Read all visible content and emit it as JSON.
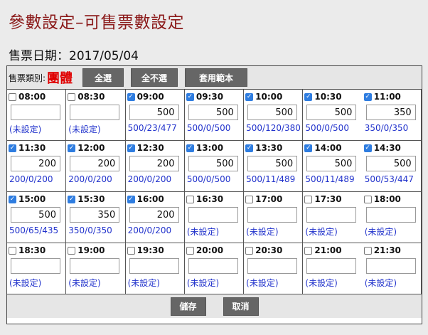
{
  "page": {
    "title": "參數設定–可售票數設定",
    "date_label": "售票日期：2017/05/04"
  },
  "toolbar": {
    "type_label": "售票類別:",
    "type_value": "團體",
    "select_all": "全選",
    "select_none": "全不選",
    "apply_template": "套用範本"
  },
  "slots": [
    {
      "time": "08:00",
      "checked": false,
      "qty": "",
      "status": "(未設定)"
    },
    {
      "time": "08:30",
      "checked": false,
      "qty": "",
      "status": "(未設定)"
    },
    {
      "time": "09:00",
      "checked": true,
      "qty": "500",
      "status": "500/23/477"
    },
    {
      "time": "09:30",
      "checked": true,
      "qty": "500",
      "status": "500/0/500"
    },
    {
      "time": "10:00",
      "checked": true,
      "qty": "500",
      "status": "500/120/380"
    },
    {
      "time": "10:30",
      "checked": true,
      "qty": "500",
      "status": "500/0/500"
    },
    {
      "time": "11:00",
      "checked": true,
      "qty": "350",
      "status": "350/0/350"
    },
    {
      "time": "11:30",
      "checked": true,
      "qty": "200",
      "status": "200/0/200"
    },
    {
      "time": "12:00",
      "checked": true,
      "qty": "200",
      "status": "200/0/200"
    },
    {
      "time": "12:30",
      "checked": true,
      "qty": "200",
      "status": "200/0/200"
    },
    {
      "time": "13:00",
      "checked": true,
      "qty": "500",
      "status": "500/0/500"
    },
    {
      "time": "13:30",
      "checked": true,
      "qty": "500",
      "status": "500/11/489"
    },
    {
      "time": "14:00",
      "checked": true,
      "qty": "500",
      "status": "500/11/489"
    },
    {
      "time": "14:30",
      "checked": true,
      "qty": "500",
      "status": "500/53/447"
    },
    {
      "time": "15:00",
      "checked": true,
      "qty": "500",
      "status": "500/65/435"
    },
    {
      "time": "15:30",
      "checked": true,
      "qty": "350",
      "status": "350/0/350"
    },
    {
      "time": "16:00",
      "checked": true,
      "qty": "200",
      "status": "200/0/200"
    },
    {
      "time": "16:30",
      "checked": false,
      "qty": "",
      "status": "(未設定)"
    },
    {
      "time": "17:00",
      "checked": false,
      "qty": "",
      "status": "(未設定)"
    },
    {
      "time": "17:30",
      "checked": false,
      "qty": "",
      "status": "(未設定)"
    },
    {
      "time": "18:00",
      "checked": false,
      "qty": "",
      "status": "(未設定)"
    },
    {
      "time": "18:30",
      "checked": false,
      "qty": "",
      "status": "(未設定)"
    },
    {
      "time": "19:00",
      "checked": false,
      "qty": "",
      "status": "(未設定)"
    },
    {
      "time": "19:30",
      "checked": false,
      "qty": "",
      "status": "(未設定)"
    },
    {
      "time": "20:00",
      "checked": false,
      "qty": "",
      "status": "(未設定)"
    },
    {
      "time": "20:30",
      "checked": false,
      "qty": "",
      "status": "(未設定)"
    },
    {
      "time": "21:00",
      "checked": false,
      "qty": "",
      "status": "(未設定)"
    },
    {
      "time": "21:30",
      "checked": false,
      "qty": "",
      "status": "(未設定)"
    }
  ],
  "footer": {
    "save": "儲存",
    "cancel": "取消"
  },
  "colors": {
    "title": "#8b1a1a",
    "type_value": "#e00000",
    "status_text": "#2233cc",
    "checkbox_checked": "#2f7de0",
    "button_bg": "#666666"
  }
}
